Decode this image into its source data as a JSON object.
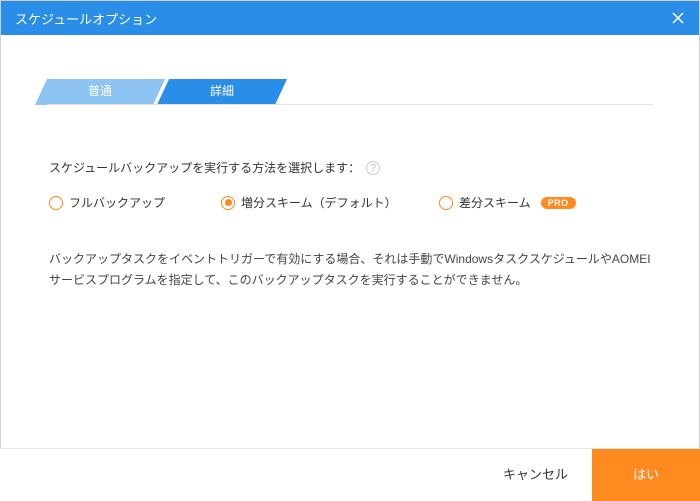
{
  "window": {
    "title": "スケジュールオプション"
  },
  "tabs": {
    "general": "普通",
    "advanced": "詳細"
  },
  "section": {
    "label": "スケジュールバックアップを実行する方法を選択します："
  },
  "options": {
    "full": "フルバックアップ",
    "incremental": "増分スキーム（デフォルト）",
    "differential": "差分スキーム",
    "pro_badge": "PRO"
  },
  "description": "バックアップタスクをイベントトリガーで有効にする場合、それは手動でWindowsタスクスケジュールやAOMEIサービスプログラムを指定して、このバックアップタスクを実行することができません。",
  "footer": {
    "cancel": "キャンセル",
    "ok": "はい"
  }
}
